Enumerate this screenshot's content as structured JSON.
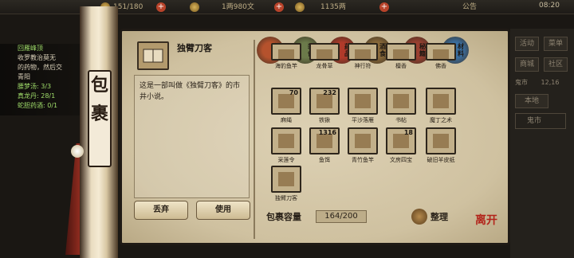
{
  "topbar": {
    "stamina": "151/180",
    "money": "1两980文",
    "silver": "1135两",
    "announcement": "公告",
    "time": "08:20"
  },
  "quest": {
    "title": "回雁峰顶",
    "lines": [
      "收罗教治莫无",
      "的药物，然后交",
      "青阳"
    ],
    "reqs": [
      {
        "label": "腰梦汤:",
        "value": "3/3"
      },
      {
        "label": "真龙丹:",
        "value": "28/1"
      },
      {
        "label": "蛇胆药酒:",
        "value": "0/1"
      }
    ]
  },
  "right_menu": {
    "buttons": [
      "活动",
      "菜单",
      "商城",
      "社区"
    ],
    "map_name": "鬼市",
    "map_coord": "12,16",
    "tab": "本地",
    "location": "鬼市"
  },
  "scroll": {
    "title": "包裹"
  },
  "selected": {
    "name": "独臂刀客",
    "description": "这是一部叫做《独臂刀客》的市井小说。"
  },
  "buttons": {
    "discard": "丢弃",
    "use": "使用"
  },
  "tabs": [
    {
      "label": "杂类",
      "color": "#b5522d"
    },
    {
      "label": "装备",
      "color": "#6b7a4a"
    },
    {
      "label": "药品",
      "color": "#b03a2a"
    },
    {
      "label": "酒食",
      "color": "#8a6a3a"
    },
    {
      "label": "秘籍",
      "color": "#9a4030"
    },
    {
      "label": "材料",
      "color": "#3b6fa0"
    }
  ],
  "items": [
    {
      "name": "海豹鱼竿",
      "qty": ""
    },
    {
      "name": "龙骨草",
      "qty": ""
    },
    {
      "name": "神行符",
      "qty": ""
    },
    {
      "name": "檀香",
      "qty": ""
    },
    {
      "name": "佛香",
      "qty": ""
    },
    {
      "name": "麻绳",
      "qty": "70"
    },
    {
      "name": "铁锹",
      "qty": "232"
    },
    {
      "name": "平沙落雁",
      "qty": ""
    },
    {
      "name": "书帖",
      "qty": ""
    },
    {
      "name": "魔丁之术",
      "qty": ""
    },
    {
      "name": "采莲令",
      "qty": ""
    },
    {
      "name": "鱼饵",
      "qty": "1316"
    },
    {
      "name": "青竹鱼竿",
      "qty": ""
    },
    {
      "name": "文房四宝",
      "qty": "18"
    },
    {
      "name": "破旧羊皮纸",
      "qty": ""
    },
    {
      "name": "独臂刀客",
      "qty": ""
    }
  ],
  "capacity": {
    "label": "包裹容量",
    "value": "164/200"
  },
  "sort_label": "整理",
  "seal_text": "离开"
}
